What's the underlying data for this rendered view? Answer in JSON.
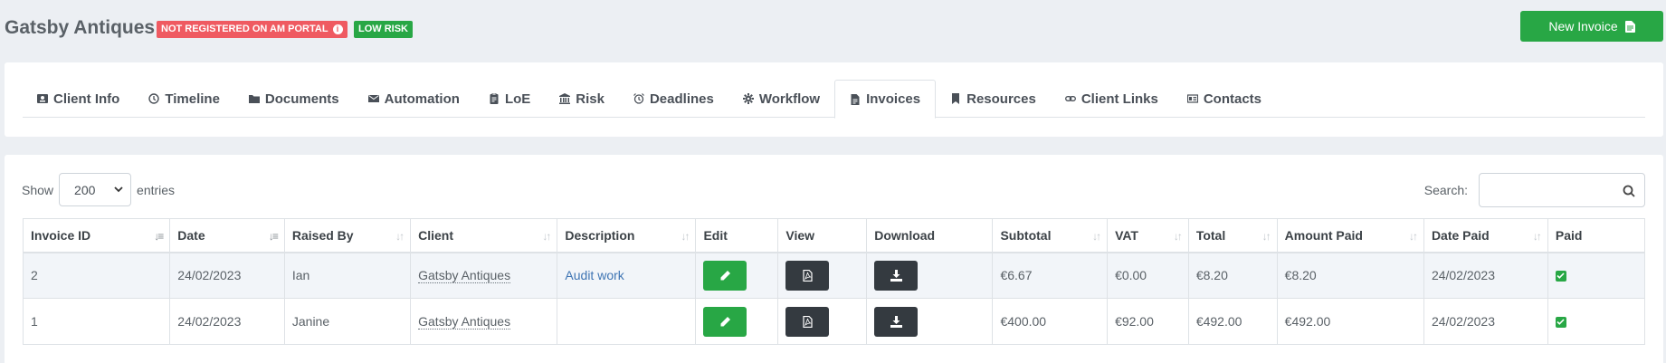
{
  "header": {
    "client_name": "Gatsby Antiques",
    "badge_registration": "NOT REGISTERED ON AM PORTAL",
    "badge_risk": "LOW RISK",
    "new_invoice_label": "New Invoice",
    "colors": {
      "danger": "#ef5a61",
      "success": "#28a745"
    }
  },
  "tabs": [
    {
      "label": "Client Info",
      "icon": "address-card-icon"
    },
    {
      "label": "Timeline",
      "icon": "clock-icon"
    },
    {
      "label": "Documents",
      "icon": "folder-icon"
    },
    {
      "label": "Automation",
      "icon": "envelope-icon"
    },
    {
      "label": "LoE",
      "icon": "clipboard-icon"
    },
    {
      "label": "Risk",
      "icon": "bank-icon"
    },
    {
      "label": "Deadlines",
      "icon": "alarm-clock-icon"
    },
    {
      "label": "Workflow",
      "icon": "gear-icon"
    },
    {
      "label": "Invoices",
      "icon": "file-icon",
      "active": true
    },
    {
      "label": "Resources",
      "icon": "bookmark-icon"
    },
    {
      "label": "Client Links",
      "icon": "link-icon"
    },
    {
      "label": "Contacts",
      "icon": "contact-card-icon"
    }
  ],
  "table_controls": {
    "show_label": "Show",
    "entries_value": "200",
    "entries_label": "entries",
    "search_label": "Search:",
    "search_value": ""
  },
  "table": {
    "columns": [
      "Invoice ID",
      "Date",
      "Raised By",
      "Client",
      "Description",
      "Edit",
      "View",
      "Download",
      "Subtotal",
      "VAT",
      "Total",
      "Amount Paid",
      "Date Paid",
      "Paid"
    ],
    "rows": [
      {
        "id": "2",
        "date": "24/02/2023",
        "raised_by": "Ian",
        "client": "Gatsby Antiques",
        "description": "Audit work",
        "subtotal": "€6.67",
        "vat": "€0.00",
        "total": "€8.20",
        "amount_paid": "€8.20",
        "date_paid": "24/02/2023",
        "paid": true
      },
      {
        "id": "1",
        "date": "24/02/2023",
        "raised_by": "Janine",
        "client": "Gatsby Antiques",
        "description": "",
        "subtotal": "€400.00",
        "vat": "€92.00",
        "total": "€492.00",
        "amount_paid": "€492.00",
        "date_paid": "24/02/2023",
        "paid": true
      }
    ]
  }
}
